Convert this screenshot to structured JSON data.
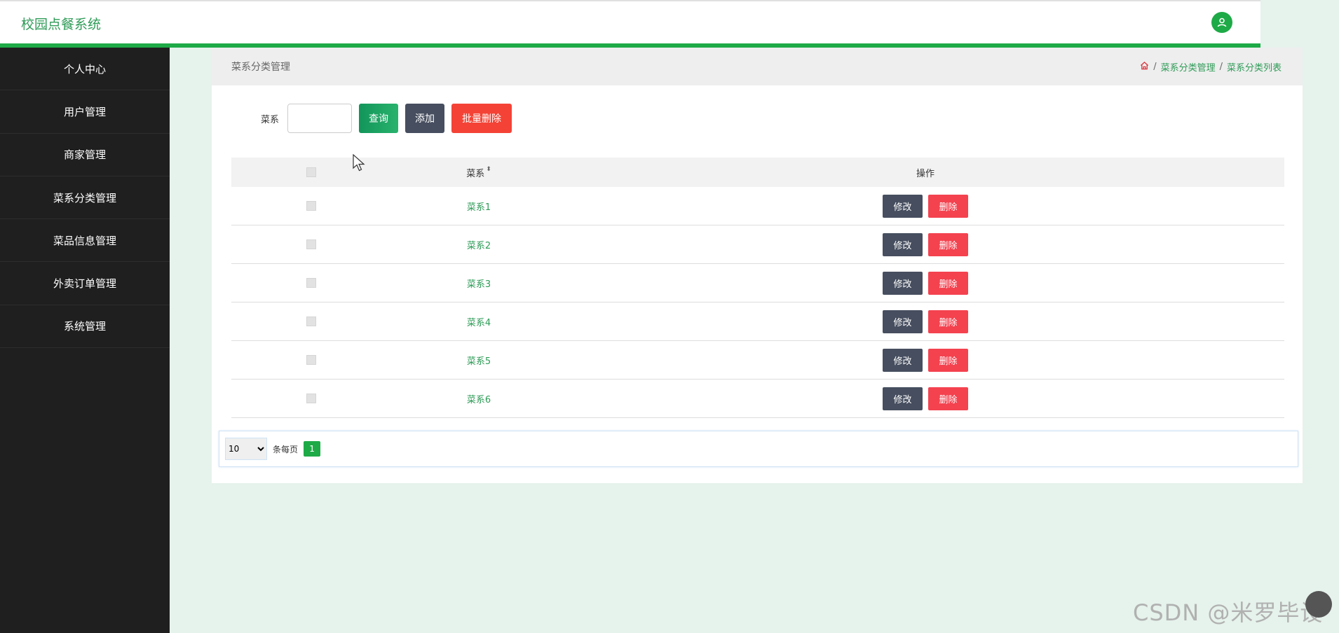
{
  "app": {
    "title": "校园点餐系统"
  },
  "sidebar": {
    "items": [
      {
        "label": "个人中心"
      },
      {
        "label": "用户管理"
      },
      {
        "label": "商家管理"
      },
      {
        "label": "菜系分类管理"
      },
      {
        "label": "菜品信息管理"
      },
      {
        "label": "外卖订单管理"
      },
      {
        "label": "系统管理"
      }
    ]
  },
  "panel": {
    "title": "菜系分类管理",
    "breadcrumb": {
      "home_icon": "home-icon",
      "items": [
        "菜系分类管理",
        "菜系分类列表"
      ],
      "separator": "/"
    }
  },
  "search": {
    "label": "菜系",
    "value": "",
    "placeholder": "",
    "query_label": "查询",
    "add_label": "添加",
    "batch_delete_label": "批量删除"
  },
  "table": {
    "columns": {
      "name": "菜系",
      "operations": "操作"
    },
    "rows": [
      {
        "name": "菜系1"
      },
      {
        "name": "菜系2"
      },
      {
        "name": "菜系3"
      },
      {
        "name": "菜系4"
      },
      {
        "name": "菜系5"
      },
      {
        "name": "菜系6"
      }
    ],
    "edit_label": "修改",
    "delete_label": "删除"
  },
  "pagination": {
    "page_size": "10",
    "per_page_label": "条每页",
    "current_page": "1"
  },
  "watermark": "CSDN @米罗毕设",
  "colors": {
    "brand": "#1eaa47",
    "sidebar_bg": "#1f1f1f",
    "danger": "#f4424f",
    "dark_button": "#464e5f"
  }
}
